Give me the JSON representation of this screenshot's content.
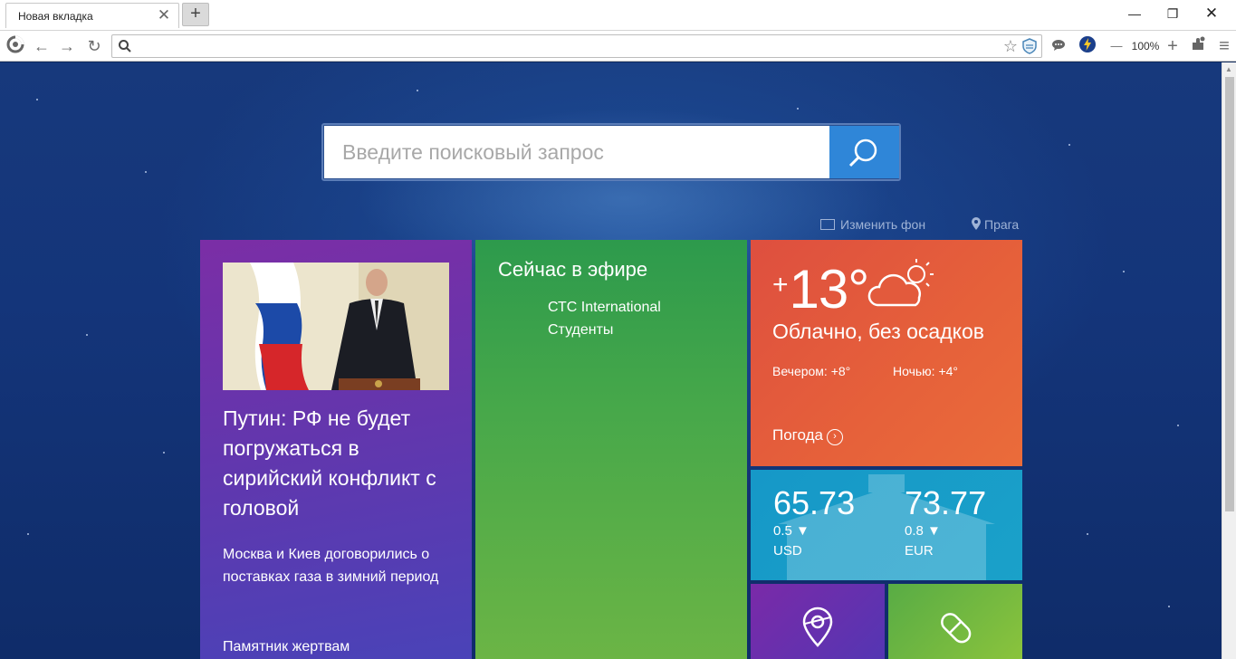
{
  "browser": {
    "tab_title": "Новая вкладка",
    "tab_close": "✕",
    "new_tab": "+",
    "window": {
      "minimize": "—",
      "restore": "❐",
      "close": "✕"
    },
    "nav": {
      "back": "←",
      "forward": "→",
      "reload": "↻",
      "star": "☆"
    },
    "url_value": "",
    "zoom": "100%",
    "zoom_minus": "—",
    "zoom_plus": "+",
    "menu": "≡"
  },
  "search": {
    "placeholder": "Введите поисковый запрос"
  },
  "links": {
    "change_bg": "Изменить фон",
    "city": "Прага"
  },
  "news": {
    "headline": "Путин: РФ не будет погружаться в сирийский конфликт с головой",
    "item2": "Москва и Киев договорились о поставках газа в зимний период",
    "item3": "Памятник жертвам"
  },
  "tv": {
    "title": "Сейчас в эфире",
    "channel": "СТС International",
    "program": "Студенты"
  },
  "weather": {
    "plus": "+",
    "temp": "13°",
    "desc": "Облачно, без осадков",
    "evening": "Вечером: +8°",
    "night": "Ночью: +4°",
    "link": "Погода",
    "link_icon": "›"
  },
  "currency": [
    {
      "value": "65.73",
      "change": "0.5 ▼",
      "name": "USD"
    },
    {
      "value": "73.77",
      "change": "0.8 ▼",
      "name": "EUR"
    }
  ],
  "colors": {
    "news_tile": "#6336ad",
    "tv_tile": "#47a84a",
    "weather_tile": "#e35a3c",
    "currency_tile": "#1a9ec9",
    "search_button": "#2f86d8"
  },
  "icons": [
    "search-icon",
    "star-icon",
    "shield-icon",
    "chat-icon",
    "lightning-icon",
    "extensions-icon",
    "menu-icon",
    "cloud-sun-icon",
    "map-pin-icon",
    "pill-icon",
    "image-icon",
    "location-pin-icon"
  ]
}
